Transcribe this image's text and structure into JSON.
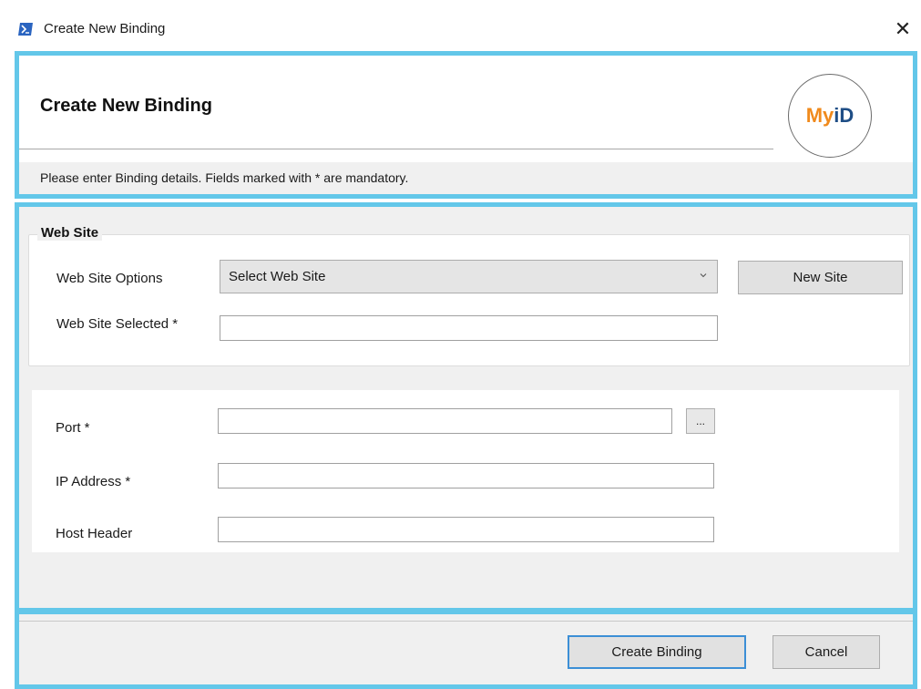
{
  "window": {
    "title": "Create New Binding",
    "close_label": "✕"
  },
  "header": {
    "title": "Create New Binding",
    "logo": {
      "part1": "My",
      "part2": "iD"
    },
    "info": "Please enter Binding details. Fields marked with * are mandatory."
  },
  "website_group": {
    "legend": "Web Site",
    "options_label": "Web Site Options",
    "options_selected": "Select Web Site",
    "new_site_label": "New Site",
    "selected_label": "Web Site Selected *",
    "selected_value": ""
  },
  "binding": {
    "port_label": "Port *",
    "port_value": "",
    "browse_label": "...",
    "ip_label": "IP Address *",
    "ip_value": "",
    "host_label": "Host Header",
    "host_value": ""
  },
  "footer": {
    "create_label": "Create Binding",
    "cancel_label": "Cancel"
  },
  "colors": {
    "accent_border": "#63c7e9",
    "logo_my": "#f08a1c",
    "logo_id": "#1f4e86",
    "primary_button_border": "#3c8fd6"
  }
}
